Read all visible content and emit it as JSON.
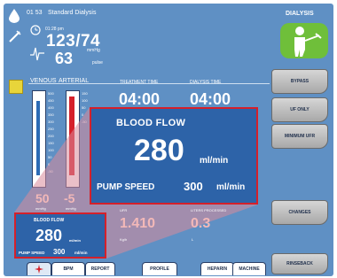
{
  "header": {
    "time": "01 53",
    "mode": "Standard Dialysis",
    "bp_time": "01:28 pm",
    "bp": "123/74",
    "bp_unit": "mmHg",
    "pulse": "63",
    "pulse_unit": "pulse"
  },
  "side_panel": {
    "title": "DIALYSIS",
    "buttons": [
      "BYPASS",
      "UF ONLY",
      "MINIMUM UFR",
      "CHANGES",
      "RINSEBACK"
    ]
  },
  "main": {
    "venous_label": "VENOUS",
    "arterial_label": "ARTERIAL",
    "venous_ticks": [
      "500",
      "450",
      "400",
      "350",
      "300",
      "250",
      "200",
      "150",
      "100",
      "50",
      "0",
      "-50"
    ],
    "arterial_ticks": [
      "150",
      "100",
      "50",
      "0",
      "-50"
    ],
    "venous_value": "50",
    "arterial_value": "-5",
    "pressure_unit": "mmHg",
    "treatment_time_label": "TREATMENT TIME",
    "treatment_time": "04:00",
    "dialysis_time_label": "DIALYSIS TIME",
    "dialysis_time": "04:00",
    "ufr_label": "UFR",
    "ufr_value": "1.410",
    "ufr_unit": "Kg/h",
    "liters_label": "LITERS PROCESSED",
    "liters_value": "0.3",
    "liters_unit": "L"
  },
  "blood_flow": {
    "label": "BLOOD FLOW",
    "value": "280",
    "unit": "ml/min",
    "pump_speed_label": "PUMP SPEED",
    "pump_speed": "300",
    "pump_unit": "ml/min"
  },
  "tabs": [
    "BPM",
    "REPORT",
    "PROFILE",
    "HEPARIN",
    "MACHINE"
  ],
  "colors": {
    "screen_bg": "#5f90c4",
    "highlight_red": "#d5202a",
    "panel_blue": "#2d63a8",
    "patient_green": "#6fbf3a"
  }
}
